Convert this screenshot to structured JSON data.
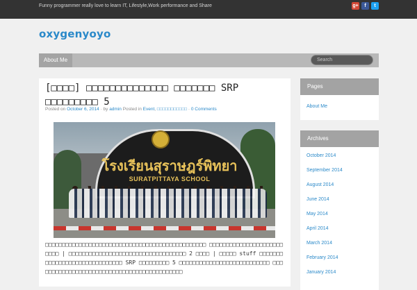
{
  "header": {
    "tagline": "Funny programmer really love to learn IT, Lifestyle,Work performance and Share",
    "social": [
      {
        "icon": "google-plus-icon",
        "glyph": "g+",
        "color": "#d34836"
      },
      {
        "icon": "facebook-icon",
        "glyph": "f",
        "color": "#3b5998"
      },
      {
        "icon": "twitter-icon",
        "glyph": "t",
        "color": "#1da1f2"
      }
    ],
    "site_title": "oxygenyoyo"
  },
  "nav": {
    "items": [
      "About Me"
    ],
    "search_placeholder": "Search"
  },
  "post": {
    "title": "[□□□□] □□□□□□□□□□□□□□ □□□□□□□ SRP □□□□□□□□□ 5",
    "meta": {
      "posted_on": "Posted on",
      "date": "October 6, 2014",
      "by": "· by",
      "author": "admin",
      "posted_in": "Posted in",
      "category": "Event",
      "sep": ",",
      "tag": "□□□□□□□□□□□",
      "dot": "·",
      "comments": "0 Comments"
    },
    "photo": {
      "sign_thai": "โรงเรียนสุราษฎร์พิทยา",
      "sign_english": "SURATPITTAYA SCHOOL"
    },
    "excerpt": "□□□□□□□□□□□□□□□□□□□□□□□□□□□□□□□□□□□□□□□□□□□□□□□□ □□□□□□□□□□□□□□□□□□□□□□□□□□ | □□□□□□□□□□□□□□□□□□□□□□□□□□□□□□□□□□□ 2 □□□□ | □□□□□ stuff □□□□□□□□□□□□□□□□□□□□□□□□□□□□□□ SRP □□□□□□□□□ 5 □□□□□□□□□□□□□□□□□□□□□□□□□□□ □□□□□□□□□□□□□□□□□□□□□□□□□□□□□□□□□□□□□□□□□□□□"
  },
  "sidebar": {
    "pages": {
      "title": "Pages",
      "links": [
        "About Me"
      ]
    },
    "archives": {
      "title": "Archives",
      "links": [
        "October 2014",
        "September 2014",
        "August 2014",
        "June 2014",
        "May 2014",
        "April 2014",
        "March 2014",
        "February 2014",
        "January 2014"
      ]
    }
  }
}
